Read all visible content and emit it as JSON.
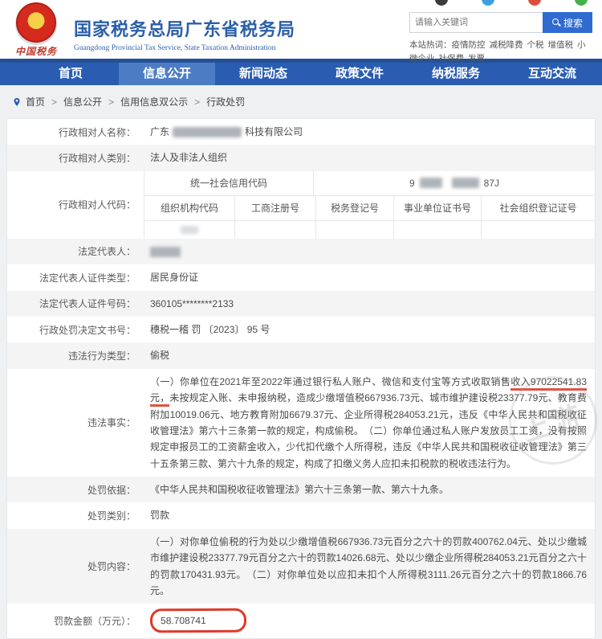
{
  "topbar": {
    "icon_colors": [
      "#3b3b3b",
      "#3d9fe0",
      "#e04b3f",
      "#45b14a"
    ]
  },
  "header": {
    "logo_text": "中国税务",
    "title": "国家税务总局广东省税务局",
    "subtitle": "Guangdong Provincial Tax Service, State Taxation Administration",
    "search": {
      "placeholder": "请输入关键词",
      "button": "搜索"
    },
    "hot": {
      "label": "本站热词：",
      "words": [
        "疫情防控",
        "减税降费",
        "个税",
        "增值税",
        "小微企业",
        "社保费",
        "发票"
      ]
    }
  },
  "nav": {
    "items": [
      {
        "label": "首页",
        "active": false
      },
      {
        "label": "信息公开",
        "active": true
      },
      {
        "label": "新闻动态",
        "active": false
      },
      {
        "label": "政策文件",
        "active": false
      },
      {
        "label": "纳税服务",
        "active": false
      },
      {
        "label": "互动交流",
        "active": false
      }
    ]
  },
  "breadcrumb": {
    "separator": ">",
    "items": [
      "首页",
      "信息公开",
      "信用信息双公示",
      "行政处罚"
    ]
  },
  "table": {
    "name": {
      "label": "行政相对人名称：",
      "prefix": "广东",
      "suffix": "科技有限公司"
    },
    "category": {
      "label": "行政相对人类别：",
      "value": "法人及非法人组织"
    },
    "code": {
      "label": "行政相对人代码：",
      "credit_label": "统一社会信用代码",
      "credit_prefix": "9",
      "credit_suffix": "87J",
      "headers": [
        "组织机构代码",
        "工商注册号",
        "税务登记号",
        "事业单位证书号",
        "社会组织登记证号"
      ]
    },
    "legal_rep": {
      "label": "法定代表人："
    },
    "id_type": {
      "label": "法定代表人证件类型：",
      "value": "居民身份证"
    },
    "id_number": {
      "label": "法定代表人证件号码：",
      "value": "360105********2133"
    },
    "doc_number": {
      "label": "行政处罚决定文书号：",
      "value": "穗税一稽 罚 〔2023〕 95 号"
    },
    "violation_type": {
      "label": "违法行为类型：",
      "value": "偷税"
    },
    "violation_fact": {
      "label": "违法事实：",
      "part1": "（一）你单位在2021年至2022年通过银行私人账户、微信和支付宝等方式收取销售",
      "highlight": "收入97022541.83元，",
      "part2": "未按规定入账、未申报纳税，造成少缴增值税667936.73元、城市维护建设税23377.79元、教育费附加10019.06元、地方教育附加6679.37元、企业所得税284053.21元，违反《中华人民共和国税收征收管理法》第六十三条第一款的规定，构成偷税。　（二）你单位通过私人账户发放员工工资，没有按照规定申报员工的工资薪金收入，少代扣代缴个人所得税，违反《中华人民共和国税收征收管理法》第三十五条第三款、第六十九条的规定，构成了扣缴义务人应扣未扣税款的税收违法行为。"
    },
    "penalty_basis": {
      "label": "处罚依据：",
      "value": "《中华人民共和国税收征收管理法》第六十三条第一款、第六十九条。"
    },
    "penalty_category": {
      "label": "处罚类别：",
      "value": "罚款"
    },
    "penalty_content": {
      "label": "处罚内容：",
      "value": "（一）对你单位偷税的行为处以少缴增值税667936.73元百分之六十的罚款400762.04元、处以少缴城市维护建设税23377.79元百分之六十的罚款14026.68元、处以少缴企业所得税284053.21元百分之六十的罚款170431.93元。　（二）对你单位处以应扣未扣个人所得税3111.26元百分之六十的罚款1866.76元。"
    },
    "penalty_amount": {
      "label": "罚款金额（万元）：",
      "value": "58.708741"
    }
  },
  "annotations": {
    "pen_color": "#e0392b",
    "watermark_text": "上游"
  }
}
